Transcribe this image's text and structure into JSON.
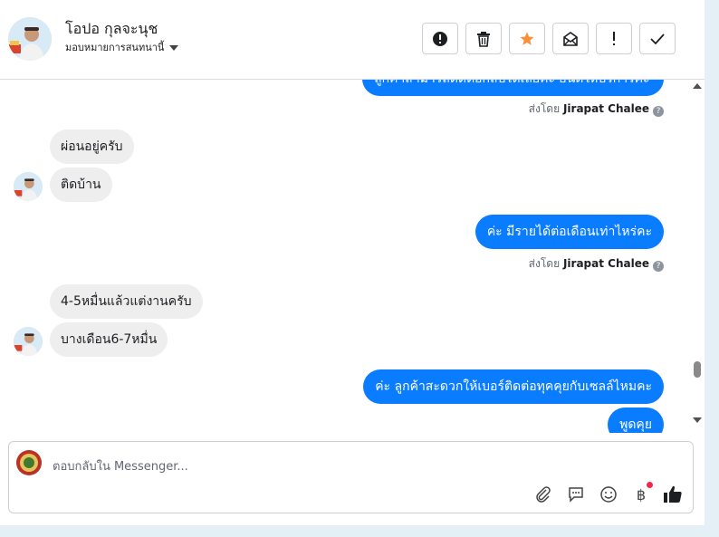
{
  "header": {
    "contact_name": "โอปอ กุลจะนุช",
    "assign_label": "มอบหมายการสนทนานี้"
  },
  "toolbar": {
    "spam_icon": "exclamation-circle-icon",
    "delete_icon": "trash-icon",
    "star_icon": "star-icon",
    "mark_unread_icon": "envelope-open-icon",
    "follow_up_icon": "exclamation-icon",
    "done_icon": "checkmark-icon",
    "star_color": "#f7923a"
  },
  "messages": {
    "out_partial": "ลูกค้าสามารถติดต่อกลับได้เลยค่ะ ยินดีให้บริการค่ะ",
    "sent_by_1_prefix": "ส่งโดย",
    "sent_by_1_name": "Jirapat Chalee",
    "in_1": "ผ่อนอยู่ครับ",
    "in_2": "ติดบ้าน",
    "out_2": "ค่ะ มีรายได้ต่อเดือนเท่าไหร่คะ",
    "sent_by_2_prefix": "ส่งโดย",
    "sent_by_2_name": "Jirapat Chalee",
    "in_3": "4-5หมื่นแล้วแต่งานครับ",
    "in_4": "บางเดือน6-7หมื่น",
    "out_3": "ค่ะ ลูกค้าสะดวกให้เบอร์ติดต่อทุคคุยกับเซลล์ไหมคะ",
    "out_4": "พูดคุย",
    "help_glyph": "?"
  },
  "composer": {
    "placeholder": "ตอบกลับใน Messenger...",
    "icons": [
      "paperclip-icon",
      "saved-reply-icon",
      "emoji-icon",
      "baht-payment-icon",
      "thumbs-up-icon"
    ],
    "payment_glyph": "฿",
    "accent": "#0a7cff",
    "notify_dot_color": "#f02849"
  }
}
